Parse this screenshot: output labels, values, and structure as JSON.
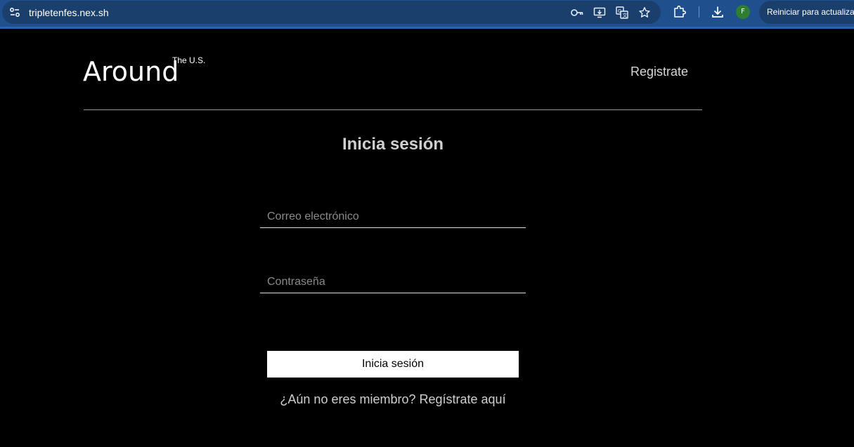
{
  "browser": {
    "url": "tripletenfes.nex.sh",
    "avatar_initial": "F",
    "restart_button_label": "Reiniciar para actualizar",
    "icons": [
      "site-info-icon",
      "password-key-icon",
      "install-app-icon",
      "translate-icon",
      "bookmark-star-icon",
      "extensions-icon",
      "download-icon"
    ]
  },
  "header": {
    "logo": "Around",
    "logo_sup": "The U.S.",
    "register_link": "Registrate"
  },
  "login": {
    "title": "Inicia sesión",
    "email_placeholder": "Correo electrónico",
    "password_placeholder": "Contraseña",
    "submit_label": "Inicia sesión",
    "signup_link": "¿Aún no eres miembro? Regístrate aquí"
  },
  "colors": {
    "page_background": "#000000",
    "browser_bar": "#1f4f8c",
    "button_background": "#ffffff"
  }
}
